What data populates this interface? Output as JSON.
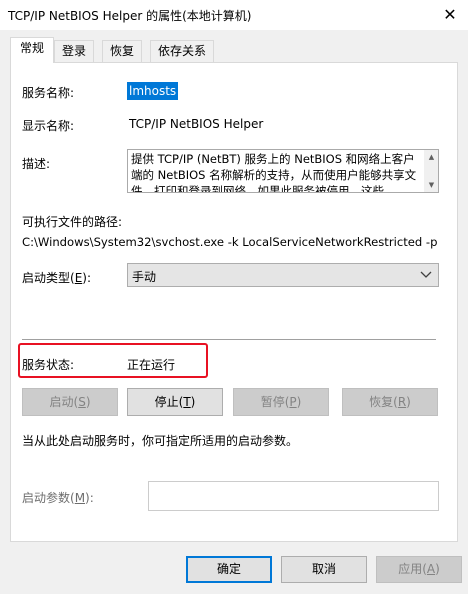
{
  "window": {
    "title": "TCP/IP NetBIOS Helper 的属性(本地计算机)",
    "close_glyph": "✕"
  },
  "tabs": [
    {
      "label": "常规",
      "active": true
    },
    {
      "label": "登录",
      "active": false
    },
    {
      "label": "恢复",
      "active": false
    },
    {
      "label": "依存关系",
      "active": false
    }
  ],
  "general": {
    "service_name_label": "服务名称:",
    "service_name_value": "lmhosts",
    "display_name_label": "显示名称:",
    "display_name_value": "TCP/IP NetBIOS Helper",
    "description_label": "描述:",
    "description_value": "提供 TCP/IP (NetBT) 服务上的 NetBIOS 和网络上客户端的 NetBIOS 名称解析的支持，从而使用户能够共享文件、打印和登录到网络。如果此服务被停用，这些",
    "exe_path_label": "可执行文件的路径:",
    "exe_path_value": "C:\\Windows\\System32\\svchost.exe -k LocalServiceNetworkRestricted -p",
    "startup_type_label": "启动类型(",
    "startup_type_label_key": "E",
    "startup_type_label_end": "):",
    "startup_type_value": "手动",
    "service_status_label": "服务状态:",
    "service_status_value": "正在运行",
    "hint_text": "当从此处启动服务时，你可指定所适用的启动参数。",
    "start_params_label": "启动参数(",
    "start_params_key": "M",
    "start_params_label_end": "):"
  },
  "service_buttons": {
    "start": {
      "pre": "启动(",
      "key": "S",
      "post": ")"
    },
    "stop": {
      "pre": "停止(",
      "key": "T",
      "post": ")"
    },
    "pause": {
      "pre": "暂停(",
      "key": "P",
      "post": ")"
    },
    "resume": {
      "pre": "恢复(",
      "key": "R",
      "post": ")"
    }
  },
  "dialog_buttons": {
    "ok": "确定",
    "cancel": "取消",
    "apply_pre": "应用(",
    "apply_key": "A",
    "apply_post": ")"
  },
  "icons": {
    "close": "close-icon",
    "dropdown": "chevron-down-icon",
    "scroll_up": "scroll-up-arrow-icon",
    "scroll_down": "scroll-down-arrow-icon"
  },
  "colors": {
    "selection": "#0078d7",
    "highlight_box": "#e81123"
  }
}
